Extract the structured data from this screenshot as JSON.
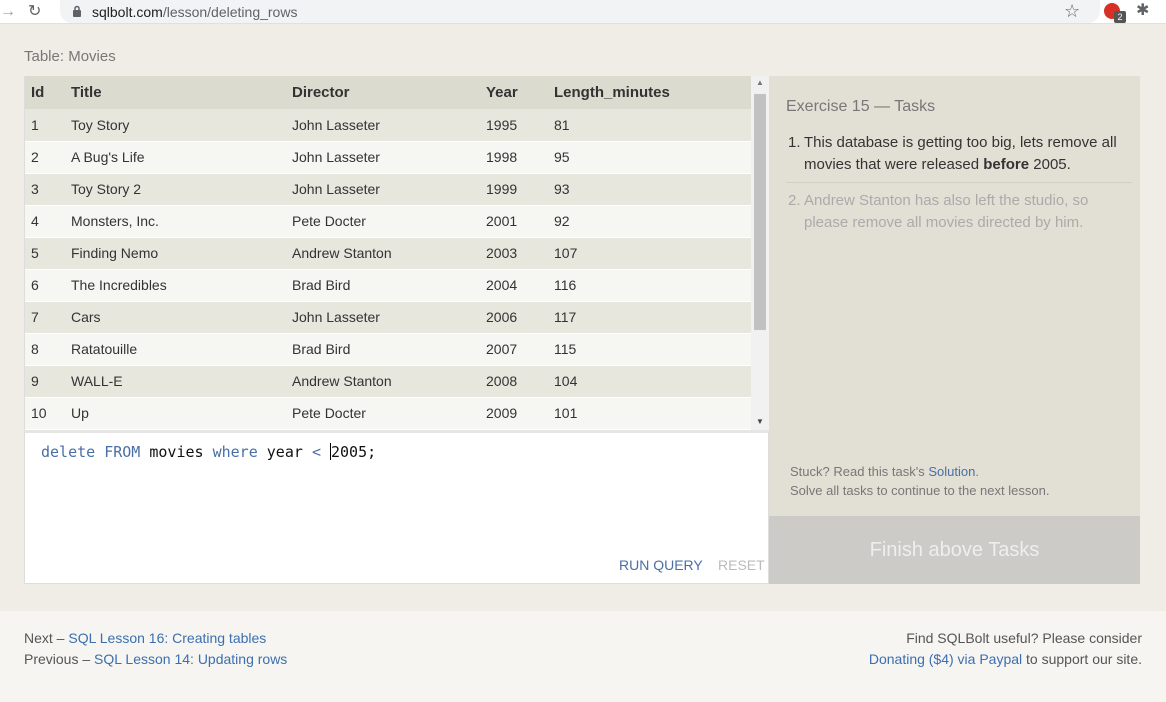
{
  "browser": {
    "back_icon": "→",
    "reload_icon": "↻",
    "url_host": "sqlbolt.com",
    "url_path": "/lesson/deleting_rows",
    "star_icon": "☆",
    "extension_badge": "2",
    "puzzle_icon": "✱"
  },
  "table": {
    "caption": "Table: Movies",
    "headers": [
      "Id",
      "Title",
      "Director",
      "Year",
      "Length_minutes"
    ],
    "rows": [
      [
        "1",
        "Toy Story",
        "John Lasseter",
        "1995",
        "81"
      ],
      [
        "2",
        "A Bug's Life",
        "John Lasseter",
        "1998",
        "95"
      ],
      [
        "3",
        "Toy Story 2",
        "John Lasseter",
        "1999",
        "93"
      ],
      [
        "4",
        "Monsters, Inc.",
        "Pete Docter",
        "2001",
        "92"
      ],
      [
        "5",
        "Finding Nemo",
        "Andrew Stanton",
        "2003",
        "107"
      ],
      [
        "6",
        "The Incredibles",
        "Brad Bird",
        "2004",
        "116"
      ],
      [
        "7",
        "Cars",
        "John Lasseter",
        "2006",
        "117"
      ],
      [
        "8",
        "Ratatouille",
        "Brad Bird",
        "2007",
        "115"
      ],
      [
        "9",
        "WALL-E",
        "Andrew Stanton",
        "2008",
        "104"
      ],
      [
        "10",
        "Up",
        "Pete Docter",
        "2009",
        "101"
      ]
    ]
  },
  "editor": {
    "code_kw1": "delete",
    "code_kw2": "FROM",
    "code_table": "movies",
    "code_kw3": "where",
    "code_col": "year",
    "code_op": "<",
    "code_val_before_caret": "",
    "code_val": "2005",
    "code_end": ";",
    "run_label": "RUN QUERY",
    "reset_label": "RESET"
  },
  "tasks": {
    "title": "Exercise 15 — Tasks",
    "task1_num": "1.",
    "task1_text": "This database is getting too big, lets remove all movies that were released ",
    "task1_bold": "before",
    "task1_end": " 2005.",
    "task2_num": "2.",
    "task2_text": "Andrew Stanton has also left the studio, so please remove all movies directed by him.",
    "stuck_prefix": "Stuck? Read this task's ",
    "solution_link": "Solution",
    "stuck_suffix": ".",
    "solve_note": "Solve all tasks to continue to the next lesson.",
    "finish_label": "Finish above Tasks"
  },
  "footer": {
    "next_prefix": "Next – ",
    "next_link": "SQL Lesson 16: Creating tables",
    "prev_prefix": "Previous – ",
    "prev_link": "SQL Lesson 14: Updating rows",
    "useful_text": "Find SQLBolt useful? Please consider",
    "donate_link": "Donating ($4) via Paypal",
    "donate_suffix": " to support our site."
  },
  "colors": {
    "accent_link": "#3b6fb0",
    "header_bg": "#dcdbd0",
    "panel_bg": "#e2e0d5",
    "finish_bg": "#cccbc7"
  }
}
